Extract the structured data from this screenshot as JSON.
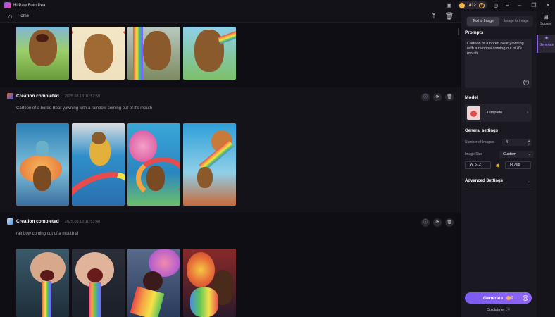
{
  "app": {
    "title": "HitPaw FotorPea"
  },
  "titlebar": {
    "credits": "1812",
    "plus_glyph": "+"
  },
  "homebar": {
    "home_label": "Home"
  },
  "feed": {
    "cards": [
      {
        "title": "Creation completed",
        "time": "2025.08.13  10:57:50",
        "prompt": "Cartoon of a bored Bear yawning with a rainbow coming out of it's mouth"
      },
      {
        "title": "Creation completed",
        "time": "2025.08.13  10:53:40",
        "prompt": "rainbow coming out of a mouth ai"
      }
    ]
  },
  "panel": {
    "mode_text_to_image": "Text to Image",
    "mode_image_to_image": "Image to Image",
    "prompts_label": "Prompts",
    "prompt_value": "Cartoon of a bored Bear yawning with a rainbow coming out of it's mouth",
    "model_label": "Model",
    "model_name": "Template",
    "general_label": "General settings",
    "num_images_label": "Number of Images",
    "num_images_value": "4",
    "image_size_label": "Image Size",
    "image_size_value": "Custom",
    "width_value": "W  512",
    "height_value": "H  768",
    "advanced_label": "Advanced Settings",
    "generate_label": "Generate",
    "generate_cost": "8",
    "disclaimer_label": "Disclaimer"
  },
  "sidebar": {
    "items": [
      {
        "label": "Square"
      },
      {
        "label": "Generate"
      }
    ]
  },
  "colors": {
    "accent": "#8b5cf6",
    "panel_bg": "#1a1922",
    "feed_bg": "#0f0e14"
  }
}
